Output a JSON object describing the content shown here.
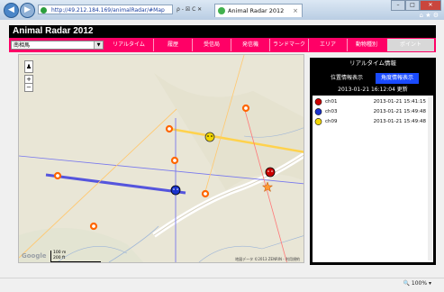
{
  "browser": {
    "address": "http://49.212.184.169/animalRadar/#Map",
    "address_tools": "ρ - ☒ C ✕",
    "tab_title": "Animal Radar 2012",
    "tab_close": "×",
    "zoom": "100%"
  },
  "app": {
    "title": "Animal Radar 2012",
    "location_select": "南相馬",
    "menu": [
      "リアルタイム",
      "履歴",
      "受信局",
      "発信機",
      "ランドマーク",
      "エリア",
      "動物種別",
      "ポイント"
    ]
  },
  "map": {
    "google_logo": "Google",
    "scale_m": "100 m",
    "scale_ft": "200 ft",
    "attribution": "地図データ ©2013 ZENRIN - 利用規約"
  },
  "panel": {
    "title": "リアルタイム情報",
    "btn_position": "位置情報表示",
    "btn_direction": "角度情報表示",
    "updated": "2013-01-21 16:12:04 更新",
    "rows": [
      {
        "name": "ch01",
        "time": "2013-01-21 15:41:15",
        "color": "#cc0000"
      },
      {
        "name": "ch03",
        "time": "2013-01-21 15:49:48",
        "color": "#1a33cc"
      },
      {
        "name": "ch09",
        "time": "2013-01-21 15:49:48",
        "color": "#e8d000"
      }
    ]
  }
}
